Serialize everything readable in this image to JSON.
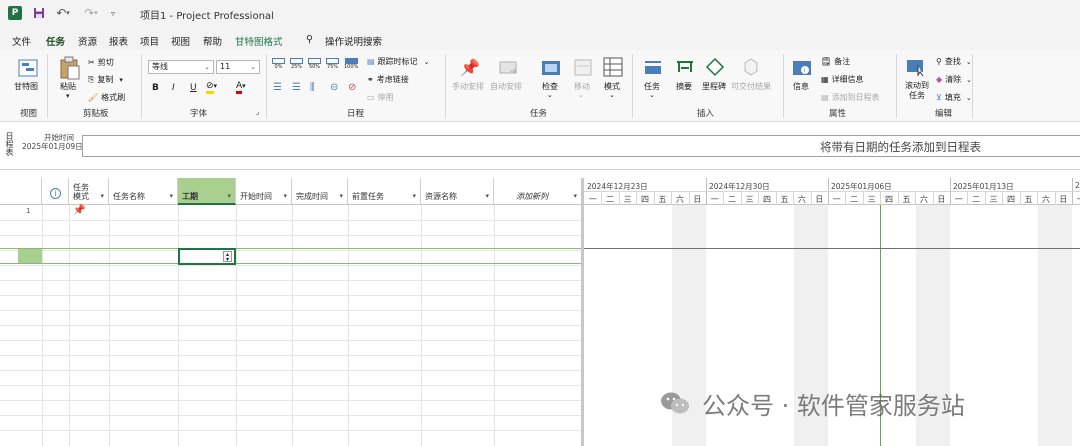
{
  "title_bar": {
    "doc_title": "项目1  -  Project Professional",
    "app_logo": "P"
  },
  "tabs": [
    {
      "label": "文件"
    },
    {
      "label": "任务",
      "active": true
    },
    {
      "label": "资源"
    },
    {
      "label": "报表"
    },
    {
      "label": "项目"
    },
    {
      "label": "视图"
    },
    {
      "label": "帮助"
    },
    {
      "label": "甘特图格式"
    },
    {
      "label": "操作说明搜索"
    }
  ],
  "ribbon": {
    "view_group": {
      "label": "视图",
      "gantt": "甘特图"
    },
    "clipboard": {
      "label": "剪贴板",
      "paste": "粘贴",
      "cut": "剪切",
      "copy": "复制",
      "painter": "格式刷"
    },
    "font": {
      "label": "字体",
      "family": "等线",
      "size": "11",
      "bold": "B",
      "italic": "I",
      "underline": "U"
    },
    "schedule": {
      "label": "日程",
      "pct": [
        "0%",
        "25%",
        "50%",
        "75%",
        "100%"
      ],
      "track": "跟踪时标记",
      "respect": "考虑链接",
      "inactivate": "停用"
    },
    "tasks": {
      "label": "任务",
      "manual": "手动安排",
      "auto": "自动安排",
      "inspect": "检查",
      "move": "移动",
      "mode": "模式"
    },
    "insert": {
      "label": "插入",
      "task": "任务",
      "summary": "摘要",
      "milestone": "里程碑",
      "deliverable": "可交付结果"
    },
    "properties": {
      "label": "属性",
      "info": "信息",
      "notes": "备注",
      "details": "详细信息",
      "add_timeline": "添加到日程表"
    },
    "editing": {
      "label": "编辑",
      "scroll": "滚动到",
      "scroll2": "任务",
      "find": "查找",
      "clear": "清除",
      "fill": "填充"
    }
  },
  "timeline": {
    "vertical_label": "日程表",
    "start_label": "开始时间",
    "start_date": "2025年01月09日",
    "hint": "将带有日期的任务添加到日程表"
  },
  "table": {
    "columns": [
      {
        "label": "任务模式"
      },
      {
        "label": "任务名称"
      },
      {
        "label": "工期"
      },
      {
        "label": "开始时间"
      },
      {
        "label": "完成时间"
      },
      {
        "label": "前置任务"
      },
      {
        "label": "资源名称"
      },
      {
        "label": "添加新列"
      }
    ],
    "rows": [
      {
        "num": "1"
      }
    ]
  },
  "gantt": {
    "weeks": [
      "2024年12月23日",
      "2024年12月30日",
      "2025年01月06日",
      "2025年01月13日",
      "2"
    ],
    "days": [
      "一",
      "二",
      "三",
      "四",
      "五",
      "六",
      "日"
    ]
  },
  "watermark": {
    "text": "公众号 · 软件管家服务站"
  },
  "colors": {
    "accent": "#217346",
    "selected_header": "#a9d08e"
  }
}
